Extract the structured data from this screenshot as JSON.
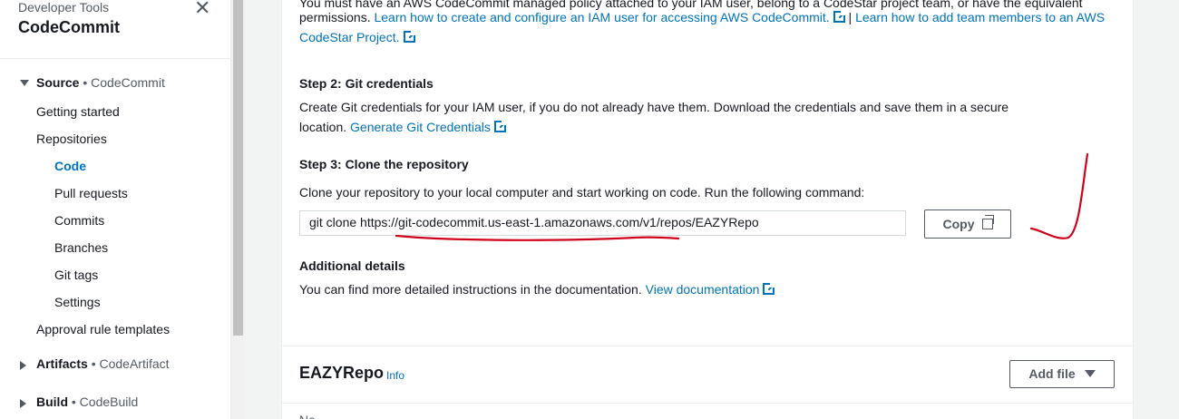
{
  "sidebar": {
    "service": "Developer Tools",
    "title": "CodeCommit",
    "close_icon": "close-icon",
    "source": {
      "label": "Source",
      "sub": "• CodeCommit"
    },
    "items": [
      {
        "label": "Getting started"
      },
      {
        "label": "Repositories"
      },
      {
        "label": "Code",
        "active": true
      },
      {
        "label": "Pull requests"
      },
      {
        "label": "Commits"
      },
      {
        "label": "Branches"
      },
      {
        "label": "Git tags"
      },
      {
        "label": "Settings"
      },
      {
        "label": "Approval rule templates"
      }
    ],
    "artifacts": {
      "label": "Artifacts",
      "sub": "• CodeArtifact"
    },
    "build": {
      "label": "Build",
      "sub": "• CodeBuild"
    }
  },
  "step1": {
    "line1": "You must have an AWS CodeCommit managed policy attached to your IAM user, belong to a CodeStar project team, or have the equivalent",
    "line2_prefix": "permissions.",
    "link1": "Learn how to create and configure an IAM user for accessing AWS CodeCommit.",
    "separator": "|",
    "link2a": "Learn how to add team members to an AWS",
    "link2b": "CodeStar Project."
  },
  "step2": {
    "heading": "Step 2: Git credentials",
    "line1": "Create Git credentials for your IAM user, if you do not already have them. Download the credentials and save them in a secure",
    "line2_prefix": "location.",
    "link": "Generate Git Credentials"
  },
  "step3": {
    "heading": "Step 3: Clone the repository",
    "description": "Clone your repository to your local computer and start working on code. Run the following command:",
    "command": "git clone https://git-codecommit.us-east-1.amazonaws.com/v1/repos/EAZYRepo",
    "copy_label": "Copy"
  },
  "additional": {
    "heading": "Additional details",
    "text": "You can find more detailed instructions in the documentation.",
    "link": "View documentation"
  },
  "repo": {
    "name": "EAZYRepo",
    "info": "Info",
    "add_file": "Add file",
    "column_head": "Na"
  },
  "colors": {
    "link": "#0073bb",
    "annotation": "#d0021b"
  }
}
